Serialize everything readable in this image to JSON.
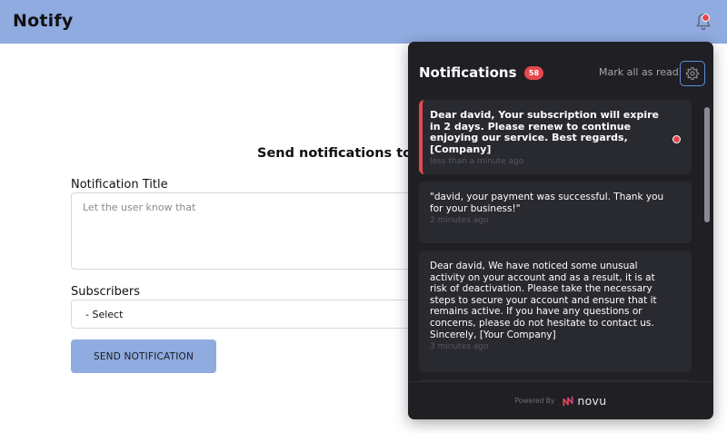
{
  "app": {
    "brand": "Notify"
  },
  "main": {
    "heading": "Send notifications to your subscribers",
    "title_label": "Notification Title",
    "title_placeholder": "Let the user know that",
    "subscribers_label": "Subscribers",
    "subscribers_selected": "- Select",
    "send_button": "SEND NOTIFICATION"
  },
  "panel": {
    "title": "Notifications",
    "unread_count": "58",
    "mark_all": "Mark all as read",
    "notifications": [
      {
        "text": "Dear david, Your subscription will expire in 2 days. Please renew to continue enjoying our service. Best regards, [Company]",
        "time": "less than a minute ago",
        "unread": true
      },
      {
        "text": "\"david, your payment was successful. Thank you for your business!\"",
        "time": "2 minutes ago",
        "unread": false
      },
      {
        "text": "Dear david, We have noticed some unusual activity on your account and as a result, it is at risk of deactivation. Please take the necessary steps to secure your account and ensure that it remains active. If you have any questions or concerns, please do not hesitate to contact us. Sincerely, [Your Company]",
        "time": "3 minutes ago",
        "unread": false
      }
    ],
    "footer_powered": "Powered By",
    "footer_brand": "novu"
  },
  "colors": {
    "topbar": "#8fabe0",
    "panel_bg": "#1f1f24",
    "card_bg": "#292930",
    "accent_red": "#e5484d",
    "settings_border": "#5d8fd9"
  },
  "icons": [
    "bell-icon",
    "gear-icon",
    "novu-logo-icon"
  ]
}
